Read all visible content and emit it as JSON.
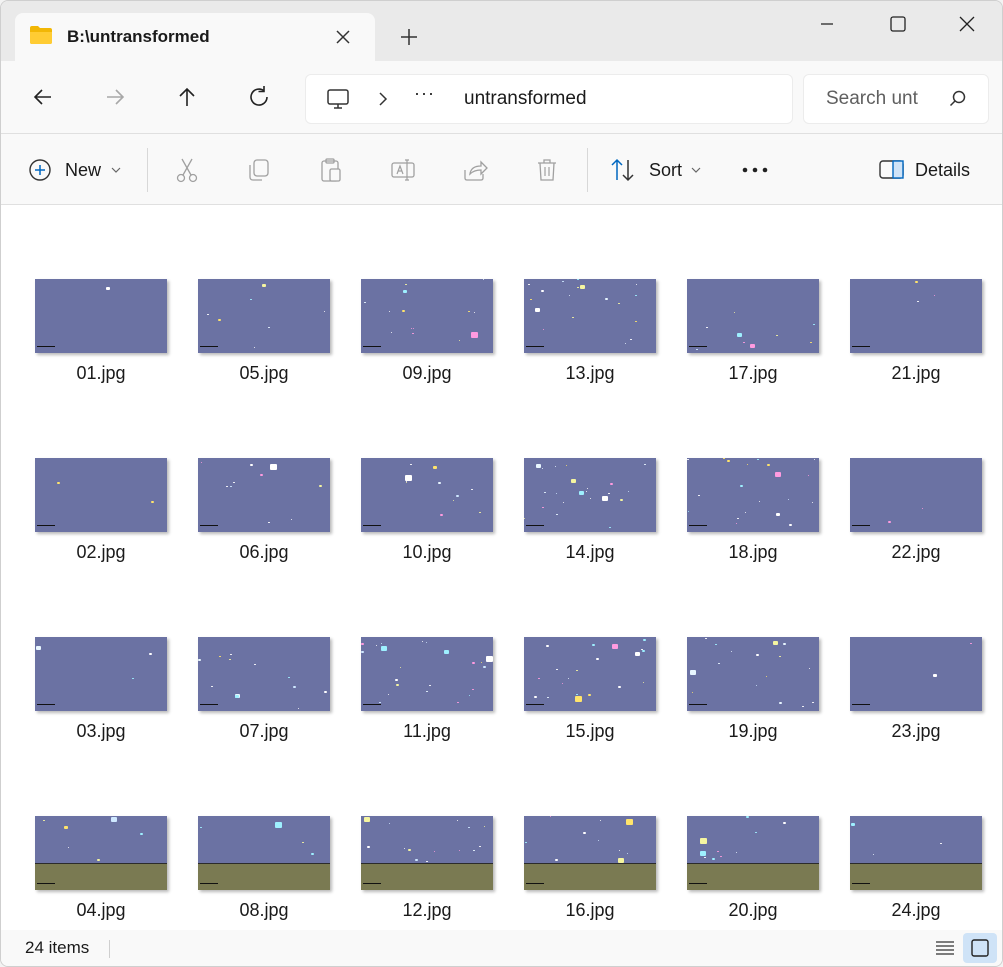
{
  "window": {
    "tab_title": "B:\\untransformed"
  },
  "address": {
    "crumb": "untransformed",
    "ellipsis": "···"
  },
  "search": {
    "placeholder": "Search unt"
  },
  "toolbar": {
    "new_label": "New",
    "sort_label": "Sort",
    "details_label": "Details"
  },
  "files": [
    {
      "name": "01.jpg",
      "floor": false
    },
    {
      "name": "05.jpg",
      "floor": false
    },
    {
      "name": "09.jpg",
      "floor": false
    },
    {
      "name": "13.jpg",
      "floor": false
    },
    {
      "name": "17.jpg",
      "floor": false
    },
    {
      "name": "21.jpg",
      "floor": false
    },
    {
      "name": "02.jpg",
      "floor": false
    },
    {
      "name": "06.jpg",
      "floor": false
    },
    {
      "name": "10.jpg",
      "floor": false
    },
    {
      "name": "14.jpg",
      "floor": false
    },
    {
      "name": "18.jpg",
      "floor": false
    },
    {
      "name": "22.jpg",
      "floor": false
    },
    {
      "name": "03.jpg",
      "floor": false
    },
    {
      "name": "07.jpg",
      "floor": false
    },
    {
      "name": "11.jpg",
      "floor": false
    },
    {
      "name": "15.jpg",
      "floor": false
    },
    {
      "name": "19.jpg",
      "floor": false
    },
    {
      "name": "23.jpg",
      "floor": false
    },
    {
      "name": "04.jpg",
      "floor": true
    },
    {
      "name": "08.jpg",
      "floor": true
    },
    {
      "name": "12.jpg",
      "floor": true
    },
    {
      "name": "16.jpg",
      "floor": true
    },
    {
      "name": "20.jpg",
      "floor": true
    },
    {
      "name": "24.jpg",
      "floor": true
    }
  ],
  "status": {
    "item_count": "24 items"
  },
  "colors": {
    "thumb_bg": "#6b72a3",
    "thumb_floor": "#7a7a52",
    "view_active": "#cfe3f7",
    "accent": "#0067c0"
  }
}
